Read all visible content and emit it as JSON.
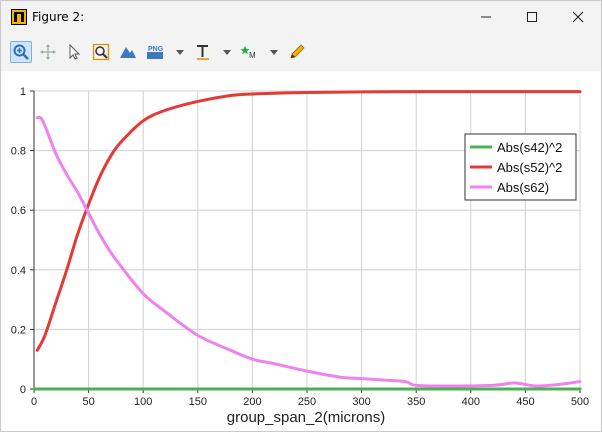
{
  "window": {
    "title": "Figure 2:"
  },
  "toolbar": {
    "tools": [
      "zoom-icon",
      "pan-icon",
      "select-icon",
      "zoom-box-icon",
      "mountain-icon",
      "png-export-icon",
      "text-icon",
      "marker-icon",
      "pencil-icon"
    ]
  },
  "chart_data": {
    "type": "line",
    "title": "",
    "xlabel": "group_span_2(microns)",
    "ylabel": "",
    "xlim": [
      0,
      500
    ],
    "ylim": [
      0,
      1
    ],
    "xticks": [
      "0",
      "50",
      "100",
      "150",
      "200",
      "250",
      "300",
      "350",
      "400",
      "450",
      "500"
    ],
    "yticks": [
      "0",
      "0.2",
      "0.4",
      "0.6",
      "0.8",
      "1"
    ],
    "grid": true,
    "legend_position": "right",
    "series": [
      {
        "name": "Abs(s42)^2",
        "color": "#4caf50",
        "x": [
          0,
          50,
          100,
          150,
          200,
          250,
          300,
          350,
          400,
          450,
          500
        ],
        "y": [
          0,
          0,
          0,
          0,
          0,
          0,
          0,
          0,
          0,
          0,
          0
        ]
      },
      {
        "name": "Abs(s52)^2",
        "color": "#e53935",
        "x": [
          3,
          10,
          20,
          30,
          40,
          50,
          60,
          70,
          80,
          100,
          120,
          150,
          180,
          200,
          250,
          300,
          350,
          400,
          450,
          500
        ],
        "y": [
          0.13,
          0.18,
          0.29,
          0.4,
          0.52,
          0.62,
          0.71,
          0.78,
          0.83,
          0.9,
          0.935,
          0.965,
          0.985,
          0.99,
          0.995,
          0.997,
          0.998,
          0.998,
          0.998,
          0.998
        ]
      },
      {
        "name": "Abs(s62)",
        "color": "#ee82ee",
        "x": [
          3,
          8,
          20,
          30,
          40,
          50,
          60,
          70,
          80,
          100,
          120,
          150,
          180,
          200,
          220,
          250,
          280,
          300,
          320,
          340,
          350,
          380,
          420,
          440,
          460,
          480,
          500
        ],
        "y": [
          0.91,
          0.9,
          0.79,
          0.72,
          0.66,
          0.59,
          0.52,
          0.46,
          0.41,
          0.32,
          0.26,
          0.18,
          0.13,
          0.1,
          0.085,
          0.06,
          0.04,
          0.035,
          0.03,
          0.025,
          0.012,
          0.01,
          0.012,
          0.02,
          0.01,
          0.015,
          0.025
        ]
      }
    ]
  }
}
